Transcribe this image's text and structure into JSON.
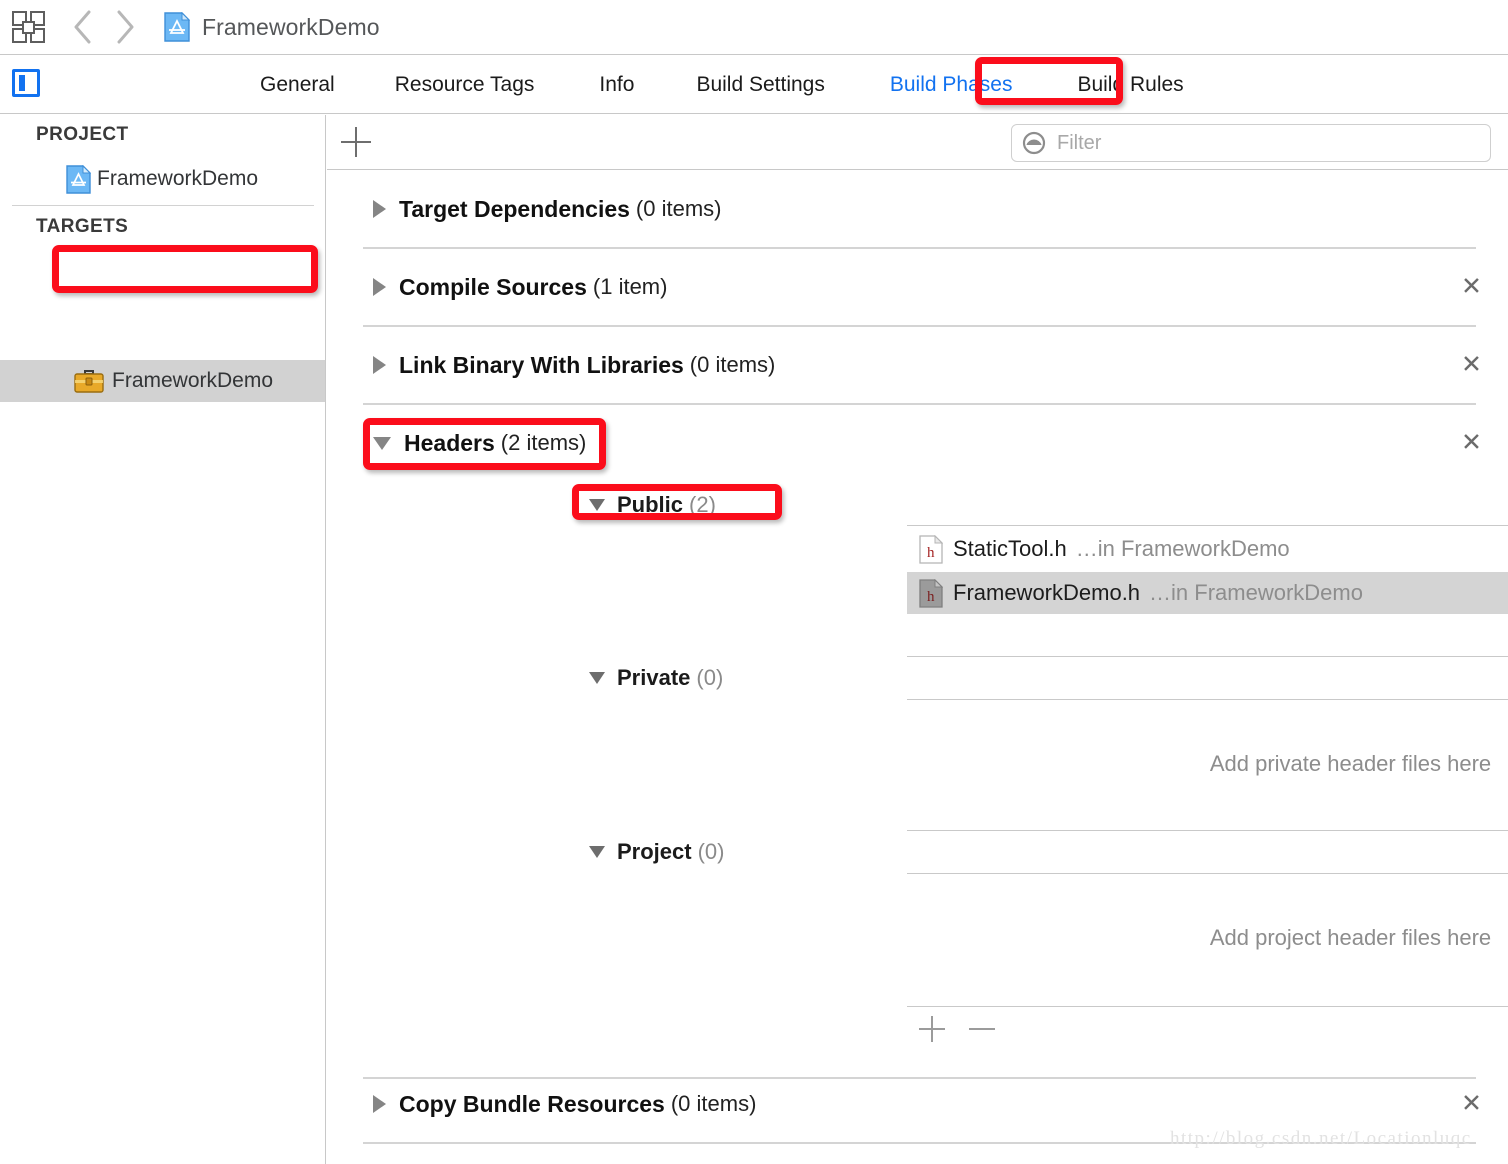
{
  "toolbar": {
    "grid_icon": "panel-grid-icon",
    "back_icon": "chevron-left-icon",
    "forward_icon": "chevron-right-icon",
    "breadcrumb_icon": "xcode-project-file-icon",
    "breadcrumb_title": "FrameworkDemo"
  },
  "tabbar": {
    "sidebar_toggle_icon": "sidebar-toggle-icon",
    "tabs": [
      {
        "label": "General",
        "active": false
      },
      {
        "label": "Resource Tags",
        "active": false
      },
      {
        "label": "Info",
        "active": false
      },
      {
        "label": "Build Settings",
        "active": false
      },
      {
        "label": "Build Phases",
        "active": true
      },
      {
        "label": "Build Rules",
        "active": false
      }
    ],
    "active_tab_color": "#1272f0"
  },
  "sidebar": {
    "project_group_label": "PROJECT",
    "project_item": {
      "label": "FrameworkDemo",
      "icon": "xcode-project-file-icon"
    },
    "targets_group_label": "TARGETS",
    "target_item": {
      "label": "FrameworkDemo",
      "icon": "toolbox-icon",
      "selected": true
    }
  },
  "content": {
    "add_phase_icon": "plus-icon",
    "filter": {
      "icon": "filter-icon",
      "placeholder": "Filter",
      "value": ""
    },
    "phases": [
      {
        "title": "Target Dependencies",
        "count": "(0 items)",
        "expanded": false,
        "removable": false
      },
      {
        "title": "Compile Sources",
        "count": "(1 item)",
        "expanded": false,
        "removable": true
      },
      {
        "title": "Link Binary With Libraries",
        "count": "(0 items)",
        "expanded": false,
        "removable": true
      },
      {
        "title": "Headers",
        "count": "(2 items)",
        "expanded": true,
        "removable": true
      },
      {
        "title": "Copy Bundle Resources",
        "count": "(0 items)",
        "expanded": false,
        "removable": true
      }
    ],
    "headers_sections": [
      {
        "title": "Public",
        "count": "(2)",
        "expanded": true,
        "files": [
          {
            "name": "StaticTool.h",
            "location": "…in FrameworkDemo",
            "icon": "h-header-file-icon",
            "selected": false
          },
          {
            "name": "FrameworkDemo.h",
            "location": "…in FrameworkDemo",
            "icon": "h-header-file-icon",
            "selected": true
          }
        ],
        "empty_hint": ""
      },
      {
        "title": "Private",
        "count": "(0)",
        "expanded": true,
        "files": [],
        "empty_hint": "Add private header files here"
      },
      {
        "title": "Project",
        "count": "(0)",
        "expanded": true,
        "files": [],
        "empty_hint": "Add project header files here"
      }
    ],
    "add_file_icon": "plus-icon",
    "remove_file_icon": "minus-icon",
    "remove_phase_icon": "close-x-icon"
  },
  "annotations": {
    "color": "#fb0d1b",
    "boxes": [
      {
        "target": "Build Phases tab"
      },
      {
        "target": "TARGETS FrameworkDemo"
      },
      {
        "target": "Headers (2 items)"
      },
      {
        "target": "Public (2)"
      }
    ]
  },
  "watermark": {
    "text": "http://blog.csdn.net/Locationluqc"
  }
}
